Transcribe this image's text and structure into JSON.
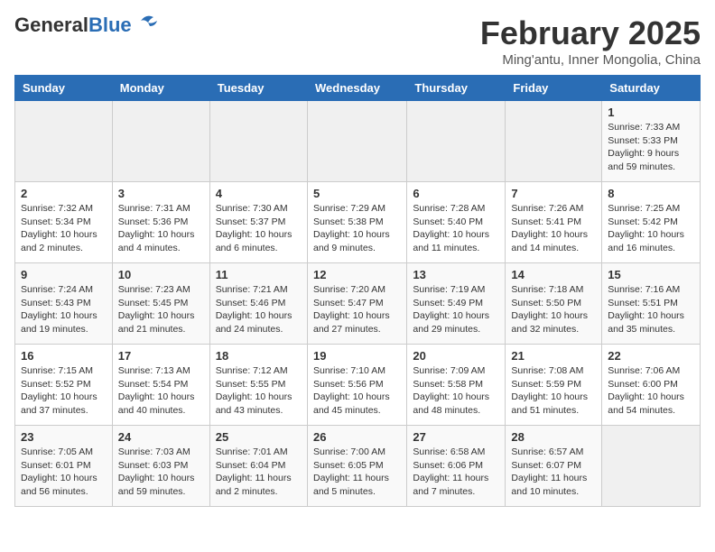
{
  "header": {
    "logo_general": "General",
    "logo_blue": "Blue",
    "title": "February 2025",
    "location": "Ming'antu, Inner Mongolia, China"
  },
  "weekdays": [
    "Sunday",
    "Monday",
    "Tuesday",
    "Wednesday",
    "Thursday",
    "Friday",
    "Saturday"
  ],
  "weeks": [
    [
      {
        "day": "",
        "info": ""
      },
      {
        "day": "",
        "info": ""
      },
      {
        "day": "",
        "info": ""
      },
      {
        "day": "",
        "info": ""
      },
      {
        "day": "",
        "info": ""
      },
      {
        "day": "",
        "info": ""
      },
      {
        "day": "1",
        "info": "Sunrise: 7:33 AM\nSunset: 5:33 PM\nDaylight: 9 hours\nand 59 minutes."
      }
    ],
    [
      {
        "day": "2",
        "info": "Sunrise: 7:32 AM\nSunset: 5:34 PM\nDaylight: 10 hours\nand 2 minutes."
      },
      {
        "day": "3",
        "info": "Sunrise: 7:31 AM\nSunset: 5:36 PM\nDaylight: 10 hours\nand 4 minutes."
      },
      {
        "day": "4",
        "info": "Sunrise: 7:30 AM\nSunset: 5:37 PM\nDaylight: 10 hours\nand 6 minutes."
      },
      {
        "day": "5",
        "info": "Sunrise: 7:29 AM\nSunset: 5:38 PM\nDaylight: 10 hours\nand 9 minutes."
      },
      {
        "day": "6",
        "info": "Sunrise: 7:28 AM\nSunset: 5:40 PM\nDaylight: 10 hours\nand 11 minutes."
      },
      {
        "day": "7",
        "info": "Sunrise: 7:26 AM\nSunset: 5:41 PM\nDaylight: 10 hours\nand 14 minutes."
      },
      {
        "day": "8",
        "info": "Sunrise: 7:25 AM\nSunset: 5:42 PM\nDaylight: 10 hours\nand 16 minutes."
      }
    ],
    [
      {
        "day": "9",
        "info": "Sunrise: 7:24 AM\nSunset: 5:43 PM\nDaylight: 10 hours\nand 19 minutes."
      },
      {
        "day": "10",
        "info": "Sunrise: 7:23 AM\nSunset: 5:45 PM\nDaylight: 10 hours\nand 21 minutes."
      },
      {
        "day": "11",
        "info": "Sunrise: 7:21 AM\nSunset: 5:46 PM\nDaylight: 10 hours\nand 24 minutes."
      },
      {
        "day": "12",
        "info": "Sunrise: 7:20 AM\nSunset: 5:47 PM\nDaylight: 10 hours\nand 27 minutes."
      },
      {
        "day": "13",
        "info": "Sunrise: 7:19 AM\nSunset: 5:49 PM\nDaylight: 10 hours\nand 29 minutes."
      },
      {
        "day": "14",
        "info": "Sunrise: 7:18 AM\nSunset: 5:50 PM\nDaylight: 10 hours\nand 32 minutes."
      },
      {
        "day": "15",
        "info": "Sunrise: 7:16 AM\nSunset: 5:51 PM\nDaylight: 10 hours\nand 35 minutes."
      }
    ],
    [
      {
        "day": "16",
        "info": "Sunrise: 7:15 AM\nSunset: 5:52 PM\nDaylight: 10 hours\nand 37 minutes."
      },
      {
        "day": "17",
        "info": "Sunrise: 7:13 AM\nSunset: 5:54 PM\nDaylight: 10 hours\nand 40 minutes."
      },
      {
        "day": "18",
        "info": "Sunrise: 7:12 AM\nSunset: 5:55 PM\nDaylight: 10 hours\nand 43 minutes."
      },
      {
        "day": "19",
        "info": "Sunrise: 7:10 AM\nSunset: 5:56 PM\nDaylight: 10 hours\nand 45 minutes."
      },
      {
        "day": "20",
        "info": "Sunrise: 7:09 AM\nSunset: 5:58 PM\nDaylight: 10 hours\nand 48 minutes."
      },
      {
        "day": "21",
        "info": "Sunrise: 7:08 AM\nSunset: 5:59 PM\nDaylight: 10 hours\nand 51 minutes."
      },
      {
        "day": "22",
        "info": "Sunrise: 7:06 AM\nSunset: 6:00 PM\nDaylight: 10 hours\nand 54 minutes."
      }
    ],
    [
      {
        "day": "23",
        "info": "Sunrise: 7:05 AM\nSunset: 6:01 PM\nDaylight: 10 hours\nand 56 minutes."
      },
      {
        "day": "24",
        "info": "Sunrise: 7:03 AM\nSunset: 6:03 PM\nDaylight: 10 hours\nand 59 minutes."
      },
      {
        "day": "25",
        "info": "Sunrise: 7:01 AM\nSunset: 6:04 PM\nDaylight: 11 hours\nand 2 minutes."
      },
      {
        "day": "26",
        "info": "Sunrise: 7:00 AM\nSunset: 6:05 PM\nDaylight: 11 hours\nand 5 minutes."
      },
      {
        "day": "27",
        "info": "Sunrise: 6:58 AM\nSunset: 6:06 PM\nDaylight: 11 hours\nand 7 minutes."
      },
      {
        "day": "28",
        "info": "Sunrise: 6:57 AM\nSunset: 6:07 PM\nDaylight: 11 hours\nand 10 minutes."
      },
      {
        "day": "",
        "info": ""
      }
    ]
  ]
}
